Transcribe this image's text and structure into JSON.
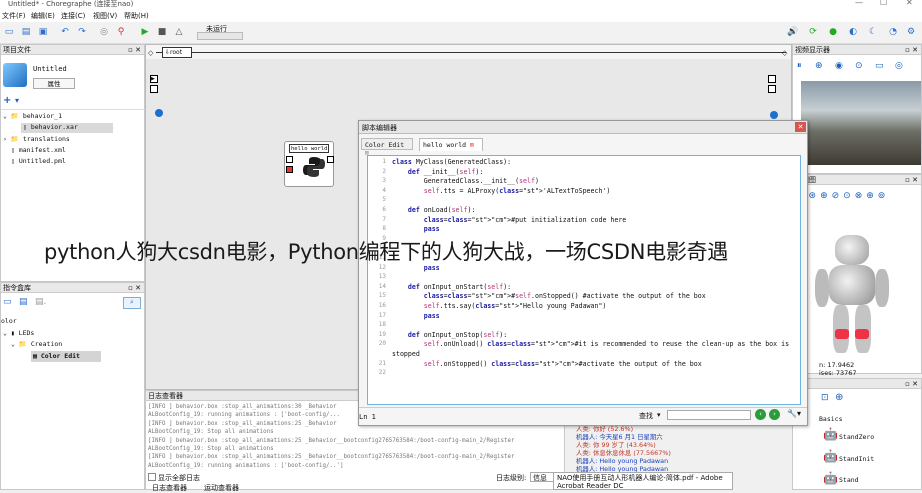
{
  "window": {
    "title": "Untitled* - Choregraphe (连接至nao)"
  },
  "menu": [
    "文件(F)",
    "编辑(E)",
    "连接(C)",
    "视图(V)",
    "帮助(H)"
  ],
  "toolbar": {
    "status": "未运行"
  },
  "project": {
    "header": "项目文件",
    "name": "Untitled",
    "props_button": "属性",
    "files": [
      "behavior_1",
      "behavior.xar",
      "translations",
      "manifest.xml",
      "Untitled.pml"
    ]
  },
  "box_library": {
    "header": "指令盒库",
    "search_prefix": "olor",
    "tree": [
      "LEDs",
      "Creation",
      "Color Edit"
    ]
  },
  "canvas": {
    "breadcrumb": "root",
    "box_label": "hello world"
  },
  "video": {
    "header": "视频显示器"
  },
  "robot_view": {
    "header": "人视图",
    "coords": [
      "n: 17.9462",
      "ises: 73767"
    ]
  },
  "poses": {
    "header": "库",
    "group": "Basics",
    "items": [
      "StandZero",
      "StandInit",
      "Stand"
    ]
  },
  "editor": {
    "title": "脚本编辑器",
    "tabs": [
      "Color Edit",
      "hello world"
    ],
    "line_status": "Ln 1",
    "search_label": "查找",
    "search_value": "",
    "lines": [
      "class MyClass(GeneratedClass):",
      "    def __init__(self):",
      "        GeneratedClass.__init__(self)",
      "        self.tts = ALProxy('ALTextToSpeech')",
      "",
      "    def onLoad(self):",
      "        #put initialization code here",
      "        pass",
      "",
      "        ",
      "        ",
      "        pass",
      "",
      "    def onInput_onStart(self):",
      "        #self.onStopped() #activate the output of the box",
      "        self.tts.say(\"Hello young Padawan\")",
      "        pass",
      "",
      "    def onInput_onStop(self):",
      "        self.onUnload() #it is recommended to reuse the clean-up as the box is",
      "stopped",
      "        self.onStopped() #activate the output of the box",
      ""
    ]
  },
  "overlay_title": "python人狗大csdn电影，Python编程下的人狗大战，一场CSDN电影奇遇",
  "log": {
    "header": "日志查看器",
    "lines": [
      "[INFO ] behavior.box :stop_all_animations:30 _Behavior",
      "ALBootConfig_19: running animations : ['boot-config/...",
      "[INFO ] behavior.box :stop_all_animations:25 _Behavior",
      "ALBootConfig_19: Stop all animations",
      "[INFO ] behavior.box :stop_all_animations:25 _Behavior__bootconfig2765763584:/boot-config-main_2/Register",
      "ALBootConfig_19: Stop all animations",
      "[INFO ] behavior.box :stop_all_animations:25 _Behavior__bootconfig2765763584:/boot-config-main_2/Register",
      "ALBootConfig_19: running animations : ['boot-config/..']"
    ],
    "show_all": "显示全部日志",
    "level_label": "日志级别:",
    "level_value": "信息",
    "tabs": [
      "日志查看器",
      "运动查看器"
    ]
  },
  "chat": {
    "lines": [
      "人类: 你好 (52.6%)",
      "机器人: 今天星6 月1 日星期六",
      "人类: 你 99 岁了 (43.64%)",
      "人类: 休息休息休息 (77.5667%)",
      "机器人: Hello young Padawan",
      "机器人: Hello young Padawan"
    ]
  },
  "taskbar_popup": "NAO使用手册互动人形机器人编论-简体.pdf - Adobe Acrobat Reader DC"
}
